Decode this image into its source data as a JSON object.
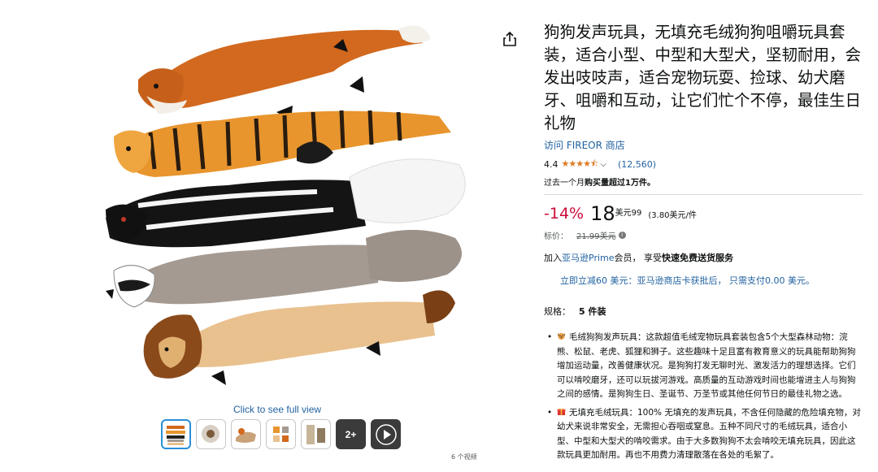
{
  "gallery": {
    "see_full_view": "Click to see full view",
    "more_images_badge": "2+",
    "video_caption": "6 个视频"
  },
  "product": {
    "title": "狗狗发声玩具，无填充毛绒狗狗咀嚼玩具套装，适合小型、中型和大型犬，坚韧耐用，会发出吱吱声，适合宠物玩耍、捡球、幼犬磨牙、咀嚼和互动，让它们忙个不停，最佳生日礼物",
    "store_link": "访问 FIREOR 商店",
    "rating_value": "4.4",
    "stars": "★★★★⯪",
    "rating_count": "(12,560)",
    "bought_prefix": "过去一个月",
    "bought_bold": "购买量超过1万件。",
    "discount": "-14%",
    "price_whole": "18",
    "price_fraction": "美元99",
    "unit_price": "(3.80美元/件",
    "list_price_label": "标价：",
    "list_price": "21.99美元",
    "prime_prefix": "加入",
    "prime_link": "亚马逊Prime",
    "prime_mid": "会员，  享受",
    "prime_bold": "快速免费送货服务",
    "card_offer": "立即立减60 美元：亚马逊商店卡获批后， 只需支付0.00 美元。",
    "spec_label": "规格：",
    "spec_value": "5 件装",
    "bullets": [
      "毛绒狗狗发声玩具：这款超值毛绒宠物玩具套装包含5个大型森林动物：浣熊、松鼠、老虎、狐狸和狮子。这些趣味十足且富有教育意义的玩具能帮助狗狗增加运动量，改善健康状况。是狗狗打发无聊时光、激发活力的理想选择。它们可以啃咬磨牙，还可以玩拔河游戏。高质量的互动游戏时间也能增进主人与狗狗之间的感情。是狗狗生日、圣诞节、万圣节或其他任何节日的最佳礼物之选。",
      "无填充毛绒玩具：100% 无填充的发声玩具，不含任何隐藏的危险填充物，对幼犬来说非常安全，无需担心吞咽或窒息。五种不同尺寸的毛绒玩具，适合小型、中型和大型犬的啃咬需求。由于大多数狗狗不太会啃咬无填充玩具，因此这款玩具更加耐用。再也不用费力清理散落在各处的毛絮了。"
    ]
  },
  "colors": {
    "link": "#2162a1",
    "discount": "#cc0c39",
    "star": "#de7921"
  }
}
